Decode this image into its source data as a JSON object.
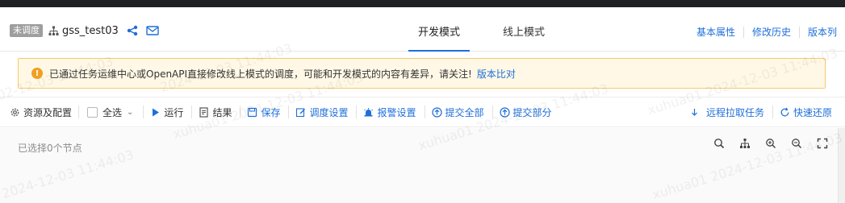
{
  "header": {
    "badge": "未调度",
    "task_name": "gss_test03",
    "mode_tabs": [
      {
        "label": "开发模式",
        "active": true
      },
      {
        "label": "线上模式",
        "active": false
      }
    ],
    "right_links": [
      "基本属性",
      "修改历史",
      "版本列"
    ]
  },
  "alert": {
    "icon": "warning-circle-icon",
    "text": "已通过任务运维中心或OpenAPI直接修改线上模式的调度，可能和开发模式的内容有差异，请关注!",
    "link": "版本比对"
  },
  "toolbar": {
    "resource_config": "资源及配置",
    "select_all": "全选",
    "run": "运行",
    "result": "结果",
    "save": "保存",
    "schedule_settings": "调度设置",
    "alarm_settings": "报警设置",
    "submit_all": "提交全部",
    "submit_part": "提交部分",
    "remote_pull": "远程拉取任务",
    "quick_restore": "快速还原"
  },
  "canvas": {
    "selected_text": "已选择0个节点",
    "tools": [
      "search-icon",
      "tree-layout-icon",
      "zoom-in-icon",
      "zoom-out-icon",
      "fullscreen-icon"
    ]
  },
  "watermark": {
    "text": "xuhua01 2024-12-03 11:44:03",
    "partial_top": "2024-12-03 11:44:03",
    "partial_mid": "02-12-03 11:44:03",
    "partial_bottom": "2024-12-03 11:44:03"
  },
  "colors": {
    "accent": "#1e6fd9",
    "alert_bg": "#fff8e6",
    "alert_border": "#f6c86b",
    "warning": "#f0a020",
    "badge_bg": "#9e9e9e"
  }
}
